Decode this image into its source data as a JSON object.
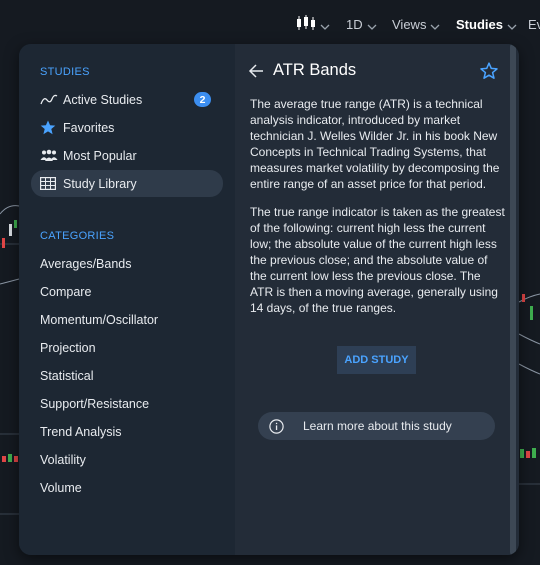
{
  "toolbar": {
    "chart_type_icon": "candlestick-icon",
    "interval": "1D",
    "views": "Views",
    "studies": "Studies",
    "events_partial": "Ev"
  },
  "sidebar": {
    "studies_heading": "STUDIES",
    "items": [
      {
        "label": "Active Studies",
        "icon": "trend-line-icon",
        "badge": "2"
      },
      {
        "label": "Favorites",
        "icon": "star-filled-icon"
      },
      {
        "label": "Most Popular",
        "icon": "people-icon"
      },
      {
        "label": "Study Library",
        "icon": "library-icon",
        "selected": true
      }
    ],
    "categories_heading": "CATEGORIES",
    "categories": [
      "Averages/Bands",
      "Compare",
      "Momentum/Oscillator",
      "Projection",
      "Statistical",
      "Support/Resistance",
      "Trend Analysis",
      "Volatility",
      "Volume"
    ]
  },
  "detail": {
    "title": "ATR Bands",
    "paragraph1": "The average true range (ATR) is a technical analysis indicator, introduced by market technician J. Welles Wilder Jr. in his book New Concepts in Technical Trading Systems, that measures market volatility by decomposing the entire range of an asset price for that period.",
    "paragraph2": "The true range indicator is taken as the greatest of the following: current high less the current low; the absolute value of the current high less the previous close; and the absolute value of the current low less the previous close. The ATR is then a moving average, generally using 14 days, of the true ranges.",
    "add_button": "ADD STUDY",
    "learn_more": "Learn more about this study"
  },
  "colors": {
    "accent": "#4aa3ff",
    "badge": "#3c8ef0",
    "panel_left": "#1d2733",
    "panel_right": "#232c38"
  }
}
